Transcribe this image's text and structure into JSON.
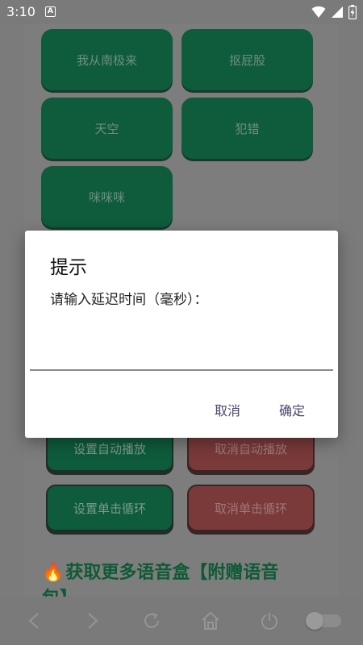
{
  "status_bar": {
    "time": "3:10",
    "notification_badge": "A",
    "icons": [
      "wifi-icon",
      "cellular-icon",
      "battery-charging-icon"
    ]
  },
  "sound_buttons": [
    {
      "label": "我从南极来"
    },
    {
      "label": "抠屁股"
    },
    {
      "label": "天空"
    },
    {
      "label": "犯错"
    },
    {
      "label": "咪咪咪"
    }
  ],
  "controls": {
    "set_auto_play": "设置自动播放",
    "cancel_auto_play": "取消自动播放",
    "set_single_loop": "设置单击循环",
    "cancel_single_loop": "取消单击循环"
  },
  "more_section": {
    "title": "获取更多语音盒【附赠语音",
    "title_line2": "包】"
  },
  "dialog": {
    "title": "提示",
    "message": "请输入延迟时间（毫秒）：",
    "input_value": "",
    "cancel_label": "取消",
    "confirm_label": "确定"
  },
  "bottom_nav": {
    "icons": [
      "back-icon",
      "forward-icon",
      "refresh-icon",
      "home-icon",
      "power-icon"
    ],
    "toggle_on": false
  },
  "colors": {
    "scrim_background": "#7b7b7b",
    "sound_button": "#0e5c3c",
    "cancel_button": "#7a3a3a",
    "dialog_button_text": "#4a4470"
  }
}
